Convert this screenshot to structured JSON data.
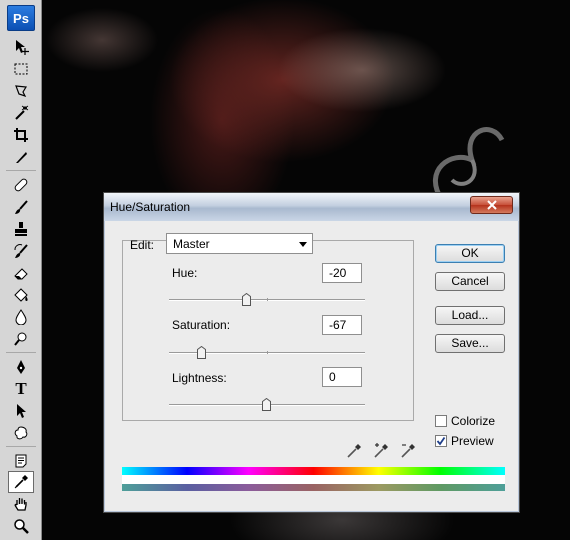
{
  "app": {
    "logo_text": "Ps"
  },
  "toolbar": {
    "tools": [
      {
        "name": "move-tool",
        "icon": "move-icon"
      },
      {
        "name": "marquee-tool",
        "icon": "marquee-icon"
      },
      {
        "name": "lasso-tool",
        "icon": "lasso-icon"
      },
      {
        "name": "magic-wand-tool",
        "icon": "magic-wand-icon"
      },
      {
        "name": "crop-tool",
        "icon": "crop-icon"
      },
      {
        "name": "slice-tool",
        "icon": "slice-icon"
      },
      {
        "name": "healing-brush-tool",
        "icon": "bandage-icon"
      },
      {
        "name": "brush-tool",
        "icon": "brush-icon"
      },
      {
        "name": "clone-stamp-tool",
        "icon": "stamp-icon"
      },
      {
        "name": "history-brush-tool",
        "icon": "history-brush-icon"
      },
      {
        "name": "eraser-tool",
        "icon": "eraser-icon"
      },
      {
        "name": "paint-bucket-tool",
        "icon": "bucket-icon"
      },
      {
        "name": "blur-tool",
        "icon": "blur-icon"
      },
      {
        "name": "dodge-tool",
        "icon": "dodge-icon"
      },
      {
        "name": "pen-tool",
        "icon": "pen-icon"
      },
      {
        "name": "type-tool",
        "icon": "type-icon",
        "label": "T"
      },
      {
        "name": "path-selection-tool",
        "icon": "arrow-icon"
      },
      {
        "name": "custom-shape-tool",
        "icon": "shape-icon"
      },
      {
        "name": "notes-tool",
        "icon": "notes-icon"
      },
      {
        "name": "eyedropper-tool",
        "icon": "eyedropper-icon",
        "active": true
      },
      {
        "name": "hand-tool",
        "icon": "hand-icon"
      },
      {
        "name": "zoom-tool",
        "icon": "zoom-icon"
      }
    ]
  },
  "dialog": {
    "title": "Hue/Saturation",
    "edit_label": "Edit:",
    "edit_value": "Master",
    "hue": {
      "label": "Hue:",
      "value": "-20"
    },
    "saturation": {
      "label": "Saturation:",
      "value": "-67"
    },
    "lightness": {
      "label": "Lightness:",
      "value": "0"
    },
    "buttons": {
      "ok": "OK",
      "cancel": "Cancel",
      "load": "Load...",
      "save": "Save..."
    },
    "colorize": {
      "label": "Colorize",
      "checked": false
    },
    "preview": {
      "label": "Preview",
      "checked": true
    },
    "colors": {
      "close_button": "#c75039",
      "default_button_border": "#3c7fb1"
    }
  }
}
